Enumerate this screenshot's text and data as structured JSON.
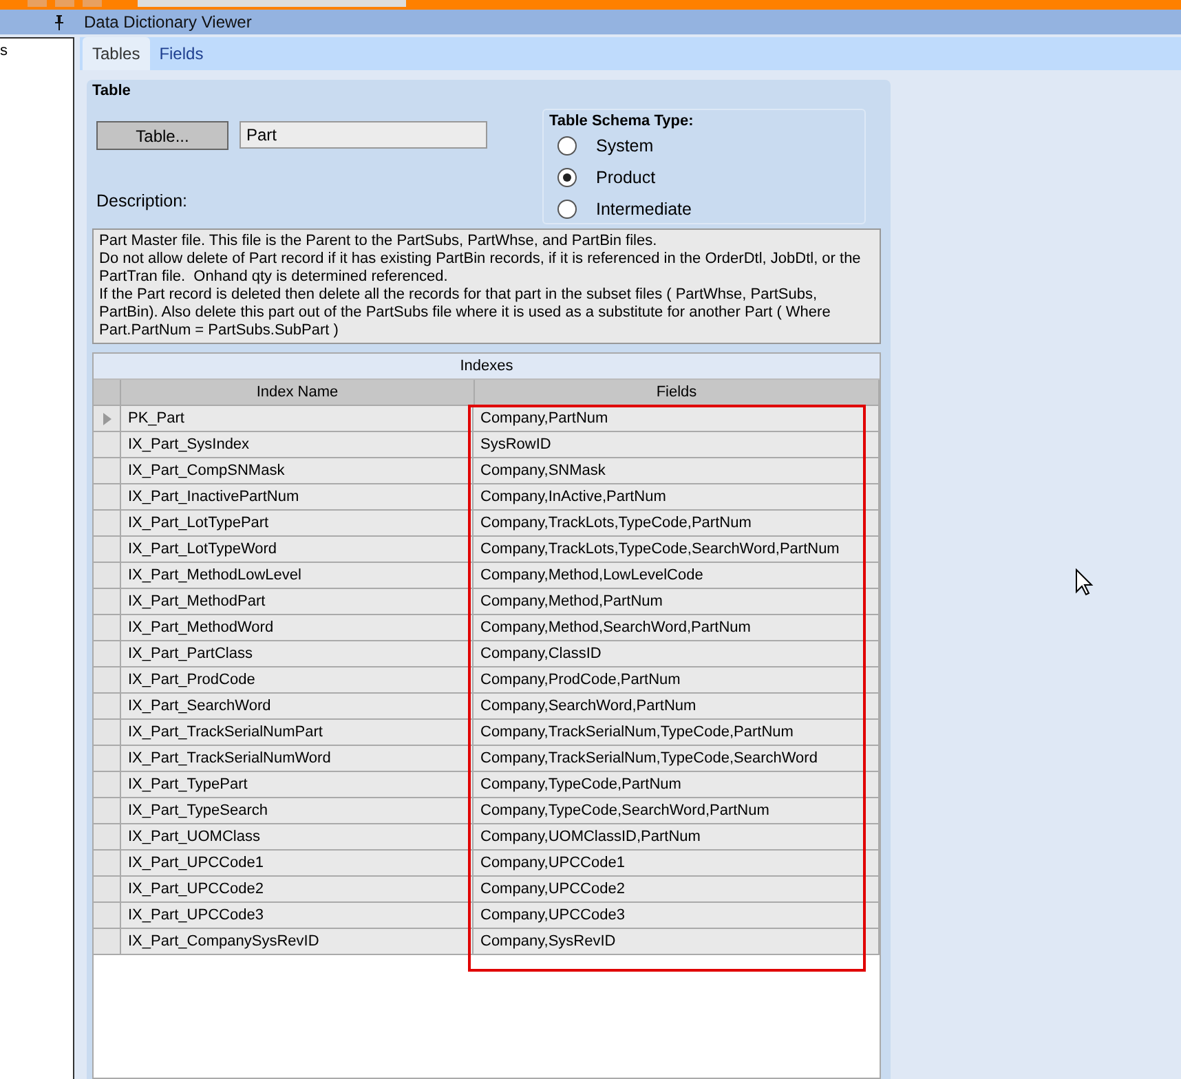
{
  "sidebar": {
    "text": "s"
  },
  "window": {
    "title": "Data Dictionary Viewer"
  },
  "tabs": [
    {
      "label": "Tables",
      "selected": true
    },
    {
      "label": "Fields",
      "selected": false
    }
  ],
  "table_group": {
    "title": "Table",
    "button": "Table...",
    "table_name": "Part",
    "description_label": "Description:",
    "description": "Part Master file. This file is the Parent to the PartSubs, PartWhse, and PartBin files.\nDo not allow delete of Part record if it has existing PartBin records, if it is referenced in the OrderDtl, JobDtl, or the PartTran file.  Onhand qty is determined referenced.\nIf the Part record is deleted then delete all the records for that part in the subset files ( PartWhse, PartSubs, PartBin). Also delete this part out of the PartSubs file where it is used as a substitute for another Part ( Where Part.PartNum = PartSubs.SubPart )"
  },
  "schema_type": {
    "title": "Table Schema Type:",
    "options": [
      {
        "label": "System",
        "selected": false
      },
      {
        "label": "Product",
        "selected": true
      },
      {
        "label": "Intermediate",
        "selected": false
      }
    ]
  },
  "indexes": {
    "title": "Indexes",
    "columns": [
      "Index Name",
      "Fields"
    ],
    "rows": [
      {
        "name": "PK_Part",
        "fields": "Company,PartNum",
        "current": true
      },
      {
        "name": "IX_Part_SysIndex",
        "fields": "SysRowID",
        "current": false
      },
      {
        "name": "IX_Part_CompSNMask",
        "fields": "Company,SNMask",
        "current": false
      },
      {
        "name": "IX_Part_InactivePartNum",
        "fields": "Company,InActive,PartNum",
        "current": false
      },
      {
        "name": "IX_Part_LotTypePart",
        "fields": "Company,TrackLots,TypeCode,PartNum",
        "current": false
      },
      {
        "name": "IX_Part_LotTypeWord",
        "fields": "Company,TrackLots,TypeCode,SearchWord,PartNum",
        "current": false
      },
      {
        "name": "IX_Part_MethodLowLevel",
        "fields": "Company,Method,LowLevelCode",
        "current": false
      },
      {
        "name": "IX_Part_MethodPart",
        "fields": "Company,Method,PartNum",
        "current": false
      },
      {
        "name": "IX_Part_MethodWord",
        "fields": "Company,Method,SearchWord,PartNum",
        "current": false
      },
      {
        "name": "IX_Part_PartClass",
        "fields": "Company,ClassID",
        "current": false
      },
      {
        "name": "IX_Part_ProdCode",
        "fields": "Company,ProdCode,PartNum",
        "current": false
      },
      {
        "name": "IX_Part_SearchWord",
        "fields": "Company,SearchWord,PartNum",
        "current": false
      },
      {
        "name": "IX_Part_TrackSerialNumPart",
        "fields": "Company,TrackSerialNum,TypeCode,PartNum",
        "current": false
      },
      {
        "name": "IX_Part_TrackSerialNumWord",
        "fields": "Company,TrackSerialNum,TypeCode,SearchWord",
        "current": false
      },
      {
        "name": "IX_Part_TypePart",
        "fields": "Company,TypeCode,PartNum",
        "current": false
      },
      {
        "name": "IX_Part_TypeSearch",
        "fields": "Company,TypeCode,SearchWord,PartNum",
        "current": false
      },
      {
        "name": "IX_Part_UOMClass",
        "fields": "Company,UOMClassID,PartNum",
        "current": false
      },
      {
        "name": "IX_Part_UPCCode1",
        "fields": "Company,UPCCode1",
        "current": false
      },
      {
        "name": "IX_Part_UPCCode2",
        "fields": "Company,UPCCode2",
        "current": false
      },
      {
        "name": "IX_Part_UPCCode3",
        "fields": "Company,UPCCode3",
        "current": false
      },
      {
        "name": "IX_Part_CompanySysRevID",
        "fields": "Company,SysRevID",
        "current": false
      }
    ]
  }
}
